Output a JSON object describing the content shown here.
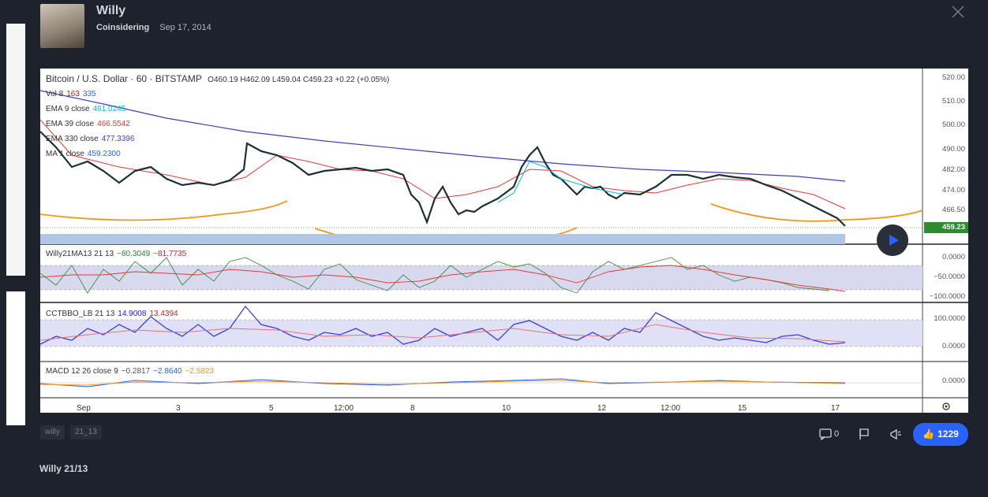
{
  "post": {
    "author": "Willy",
    "category": "Coinsidering",
    "date": "Sep 17, 2014",
    "title": "Willy 21/13",
    "tags": [
      "willy",
      "21_13"
    ],
    "comments": "0",
    "likes": "1229"
  },
  "chart": {
    "symbol": "Bitcoin / U.S. Dollar · 60 · BITSTAMP",
    "ohlc": "O460.19 H462.09 L459.04 C459.23 +0.22 (+0.05%)",
    "legend": [
      {
        "label": "Vol 8",
        "v1": "163",
        "v2": "335",
        "color1": "#b22222",
        "color2": "#2962ff"
      },
      {
        "label": "EMA 9 close",
        "v1": "461.0245",
        "color1": "#00bcd4"
      },
      {
        "label": "EMA 39 close",
        "v1": "466.5542",
        "color1": "#e53935"
      },
      {
        "label": "EMA 330 close",
        "v1": "477.3396",
        "color1": "#3f3fbf"
      },
      {
        "label": "MA 1 close",
        "v1": "459.2300",
        "color1": "#2962ff"
      }
    ],
    "price_axis": [
      "520.00",
      "510.00",
      "500.00",
      "490.00",
      "482.00",
      "474.00",
      "466.50",
      "459.23"
    ],
    "last_price": "459.23",
    "osc1": {
      "label": "Willy21MA13 21 13",
      "v1": "−80.3049",
      "v2": "−81.7735",
      "axis": [
        "0.0000",
        "−50.0000",
        "−100.0000"
      ]
    },
    "osc2": {
      "label": "CCTBBO_LB 21 13",
      "v1": "14.9008",
      "v2": "13.4394",
      "axis": [
        "100.0000",
        "0.0000"
      ]
    },
    "macd": {
      "label": "MACD 12 26 close 9",
      "v1": "−0.2817",
      "v2": "−2.8640",
      "v3": "−2.5823",
      "axis": [
        "0.0000"
      ]
    },
    "time_axis": [
      "Sep",
      "3",
      "5",
      "12:00",
      "8",
      "10",
      "12",
      "12:00",
      "15",
      "17"
    ]
  }
}
